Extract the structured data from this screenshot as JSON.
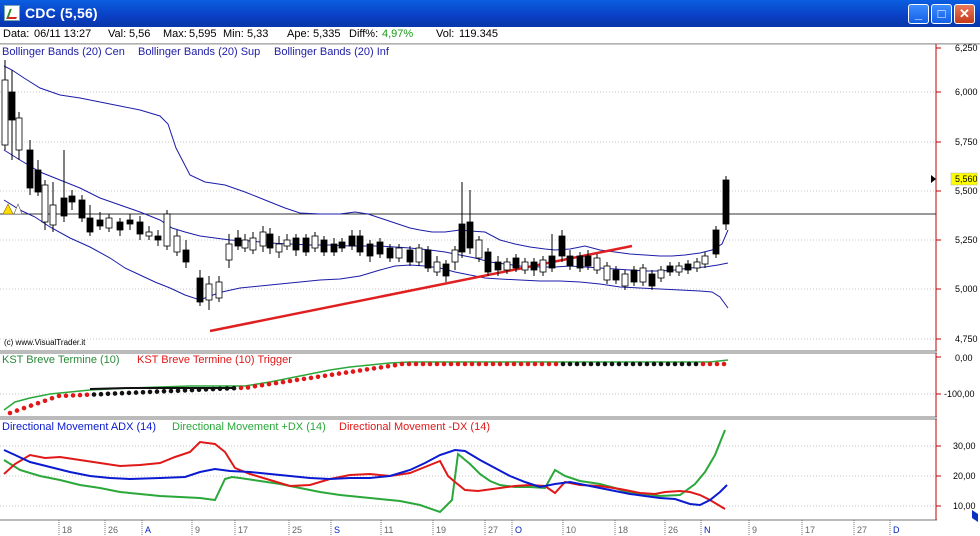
{
  "window": {
    "title": "CDC (5,56)",
    "min_glyph": "_",
    "max_glyph": "□",
    "close_glyph": "✕"
  },
  "info": {
    "data_label": "Data:",
    "data_value": "06/11 13:27",
    "val_label": "Val:",
    "val_value": "5,56",
    "max_label": "Max:",
    "max_value": "5,595",
    "min_label": "Min:",
    "min_value": "5,33",
    "ape_label": "Ape:",
    "ape_value": "5,335",
    "diff_label": "Diff%:",
    "diff_value": "4,97%",
    "vol_label": "Vol:",
    "vol_value": "119.345"
  },
  "colors": {
    "band": "#1c1ca8",
    "trend": "#e02020",
    "adx": "#0a1ad0",
    "pdx": "#2aa83a",
    "mdx": "#e01818",
    "axis": "#c00000",
    "last_price_bg": "#ffff00"
  },
  "price_panel": {
    "legend": [
      "Bollinger Bands (20) Cen",
      "Bollinger Bands (20) Sup",
      "Bollinger Bands (20) Inf"
    ],
    "y_ticks": [
      "6,250",
      "6,000",
      "5,750",
      "5,500",
      "5,250",
      "5,000",
      "4,750"
    ],
    "last_price": "5,560",
    "copyright": "(c) www.VisualTrader.it"
  },
  "kst_panel": {
    "legend": [
      "KST Breve Termine (10)",
      "KST Breve Termine (10) Trigger"
    ],
    "y_ticks": [
      "0,00",
      "-100,00"
    ]
  },
  "dm_panel": {
    "legend": [
      "Directional Movement ADX (14)",
      "Directional Movement +DX (14)",
      "Directional Movement -DX (14)"
    ],
    "y_ticks": [
      "30,00",
      "20,00",
      "10,00"
    ]
  },
  "x_axis": [
    "18",
    "26",
    "A",
    "9",
    "17",
    "25",
    "S",
    "11",
    "19",
    "27",
    "O",
    "10",
    "18",
    "26",
    "N",
    "9",
    "17",
    "27",
    "D"
  ]
}
